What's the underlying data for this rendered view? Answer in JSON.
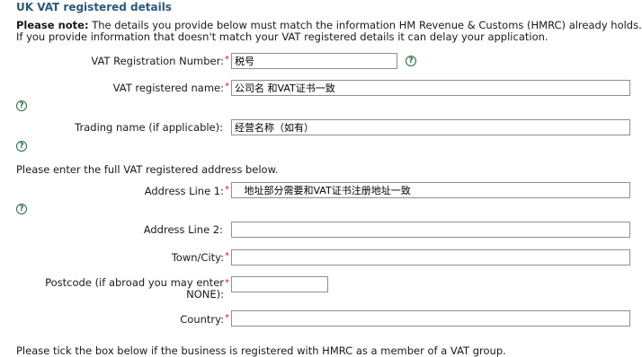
{
  "section": {
    "title": "UK VAT registered details"
  },
  "note": {
    "lead": "Please note:",
    "text1": " The details you provide below must match the information HM Revenue & Customs (HMRC) already holds.",
    "text2": "If you provide information that doesn't match your VAT registered details it can delay your application."
  },
  "help_glyph": "?",
  "required_mark": "*",
  "fields": {
    "vat_number": {
      "label": "VAT Registration Number:",
      "value": "税号"
    },
    "vat_name": {
      "label": "VAT registered name:",
      "value": "公司名 和VAT证书一致"
    },
    "trading_name": {
      "label": "Trading name (if applicable):",
      "value": "经营名称（如有）"
    },
    "address_line1": {
      "label": "Address Line 1:",
      "value": "   地址部分需要和VAT证书注册地址一致"
    },
    "address_line2": {
      "label": "Address Line 2:",
      "value": ""
    },
    "town_city": {
      "label": "Town/City:",
      "value": ""
    },
    "postcode": {
      "label_line1": "Postcode (if abroad you may enter",
      "label_line2": "NONE):",
      "value": ""
    },
    "country": {
      "label": "Country:",
      "value": ""
    }
  },
  "address_intro": "Please enter the full VAT registered address below.",
  "vat_group_text": "Please tick the box below if the business is registered with HMRC as a member of a VAT group."
}
